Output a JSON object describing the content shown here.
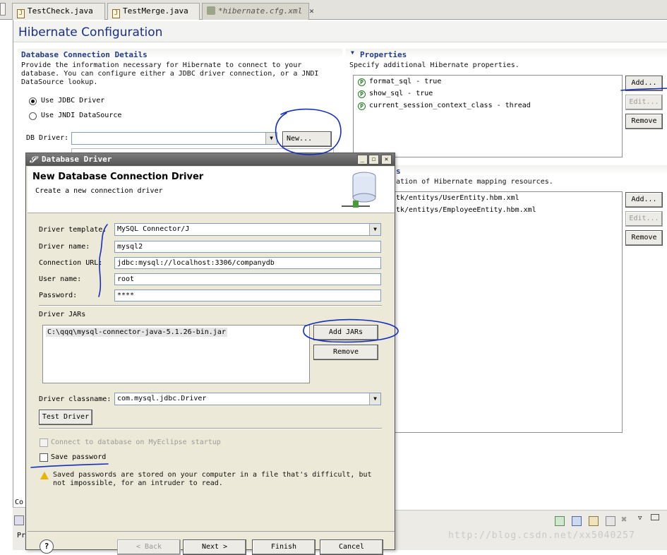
{
  "tabs": [
    {
      "label": "TestCheck.java",
      "icon": "java-file-icon"
    },
    {
      "label": "TestMerge.java",
      "icon": "java-file-icon"
    },
    {
      "label": "*hibernate.cfg.xml",
      "icon": "xml-file-icon",
      "close": "✕"
    }
  ],
  "page": {
    "title": "Hibernate  Configuration"
  },
  "db": {
    "section_title": "Database Connection Details",
    "description": [
      "Provide the information necessary for Hibernate to connect to your",
      "database.  You can configure either a JDBC driver connection, or a JNDI",
      "DataSource lookup."
    ],
    "radio_jdbc": "Use JDBC Driver",
    "radio_jndi": "Use JNDI DataSource",
    "driver_label": "DB Driver:",
    "driver_value": "",
    "new_button": "New..."
  },
  "properties": {
    "section_title": "Properties",
    "description": "Specify additional Hibernate properties.",
    "items": [
      "format_sql - true",
      "show_sql - true",
      "current_session_context_class - thread"
    ],
    "add": "Add...",
    "edit": "Edit...",
    "remove": "Remove"
  },
  "mappings": {
    "section_title_fragment": "s",
    "description_fragment": "ation of Hibernate mapping resources.",
    "items": [
      "tk/entitys/UserEntity.hbm.xml",
      "tk/entitys/EmployeeEntity.hbm.xml"
    ],
    "add": "Add...",
    "edit": "Edit...",
    "remove": "Remove"
  },
  "dialog": {
    "title": "Database Driver",
    "heading": "New Database Connection Driver",
    "subheading": "Create a new connection driver",
    "fields": {
      "template_label": "Driver template:",
      "template_value": "MySQL Connector/J",
      "name_label": "Driver name:",
      "name_value": "mysql2",
      "url_label": "Connection URL:",
      "url_value": "jdbc:mysql://localhost:3306/companydb",
      "user_label": "User name:",
      "user_value": "root",
      "password_label": "Password:",
      "password_value": "****"
    },
    "jars_label": "Driver JARs",
    "jars": [
      "C:\\qqq\\mysql-connector-java-5.1.26-bin.jar"
    ],
    "add_jars": "Add JARs",
    "remove_jar": "Remove",
    "classname_label": "Driver classname:",
    "classname_value": "com.mysql.jdbc.Driver",
    "test_driver": "Test Driver",
    "connect_startup": "Connect to database on MyEclipse startup",
    "save_password": "Save password",
    "warning": [
      "Saved passwords are stored on your computer in a file that's difficult, but",
      "not impossible, for an intruder to read."
    ],
    "back": "< Back",
    "next": "Next >",
    "finish": "Finish",
    "cancel": "Cancel",
    "help": "?"
  },
  "status": {
    "left_fragment": "Co",
    "tab_fragment": "Pr"
  },
  "watermark": "http://blog.csdn.net/xx5040257",
  "colors": {
    "ink": "#1530b8",
    "title": "#18308a",
    "section": "#1f3c8c"
  }
}
